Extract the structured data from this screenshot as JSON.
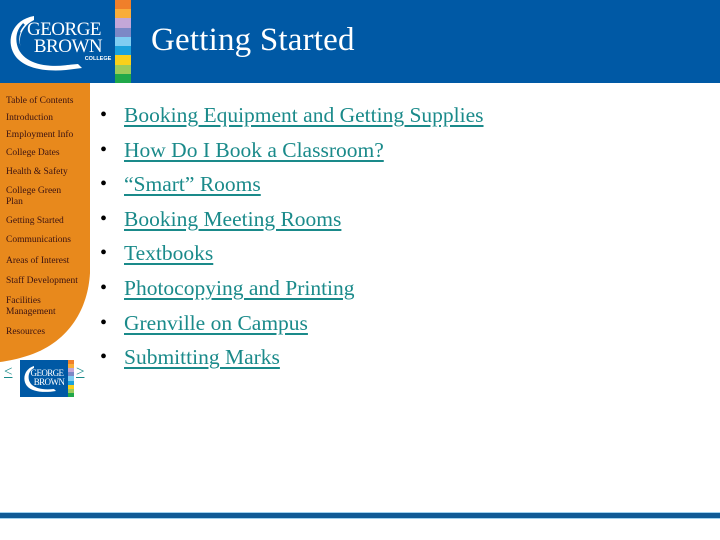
{
  "header": {
    "title": "Getting Started",
    "logo": {
      "line1": "GEORGE",
      "line2": "BROWN",
      "line3": "COLLEGE",
      "icon": "george-brown-logo"
    },
    "background_color": "#0059a5",
    "color_strip": [
      "#f07f2a",
      "#f9ad3a",
      "#c3a7d8",
      "#7c88c6",
      "#7fcdf2",
      "#1aa1dc",
      "#f9d01a",
      "#9bcb5a",
      "#20a84a"
    ]
  },
  "sidebar": {
    "background_color": "#e8891c",
    "items": [
      {
        "label": "Table of Contents"
      },
      {
        "label": "Introduction"
      },
      {
        "label": "Employment Info"
      },
      {
        "label": "College Dates"
      },
      {
        "label": "Health & Safety"
      },
      {
        "label": "College Green Plan"
      },
      {
        "label": "Getting Started"
      },
      {
        "label": "Communications"
      },
      {
        "label": "Areas of Interest"
      },
      {
        "label": "Staff Development"
      },
      {
        "label": "Facilities Management"
      },
      {
        "label": "Resources"
      }
    ]
  },
  "nav_footer": {
    "prev_label": "<",
    "next_label": ">",
    "home_icon": "george-brown-mini-logo"
  },
  "content": {
    "link_color": "#1a8a8a",
    "links": [
      {
        "label": "Booking Equipment and Getting Supplies"
      },
      {
        "label": "How Do I Book a Classroom?"
      },
      {
        "label": "“Smart” Rooms"
      },
      {
        "label": "Booking Meeting Rooms"
      },
      {
        "label": "Textbooks"
      },
      {
        "label": "Photocopying and Printing"
      },
      {
        "label": "Grenville on Campus"
      },
      {
        "label": "Submitting Marks"
      }
    ]
  }
}
